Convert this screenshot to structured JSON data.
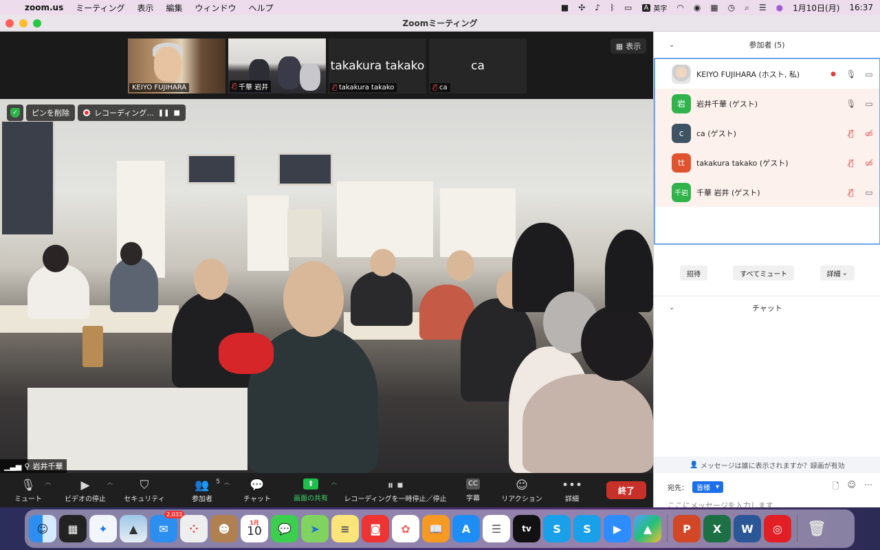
{
  "menubar": {
    "app": "zoom.us",
    "menus": [
      "ミーティング",
      "表示",
      "編集",
      "ウィンドウ",
      "ヘルプ"
    ],
    "ime": "A",
    "ime_label": "英字",
    "date": "1月10日(月)",
    "time": "16:37"
  },
  "window": {
    "title": "Zoomミーティング"
  },
  "thumbnails": [
    {
      "name": "KEIYO FUJIHARA"
    },
    {
      "name": "千華 岩井"
    },
    {
      "name": "takakura takako",
      "big": "takakura takako"
    },
    {
      "name": "ca",
      "big": "ca"
    }
  ],
  "view_button": "表示",
  "overlay": {
    "unpin": "ピンを削除",
    "recording": "レコーディング..."
  },
  "speaker_name": "岩井千華",
  "toolbar": {
    "mute": "ミュート",
    "video": "ビデオの停止",
    "security": "セキュリティ",
    "participants": "参加者",
    "participants_count": "5",
    "chat": "チャット",
    "share": "画面の共有",
    "recording": "レコーディングを一時停止／停止",
    "captions": "字幕",
    "captions_icon": "CC",
    "reactions": "リアクション",
    "more": "詳細",
    "end": "終了"
  },
  "participants_panel": {
    "title": "参加者 (5)",
    "rows": [
      {
        "avatar": "",
        "name": "KEIYO FUJIHARA (ホスト, 私)",
        "color": "#cfcfcf"
      },
      {
        "avatar": "岩",
        "name": "岩井千華 (ゲスト)",
        "color": "#2fb34a"
      },
      {
        "avatar": "c",
        "name": "ca (ゲスト)",
        "color": "#3e5363"
      },
      {
        "avatar": "tt",
        "name": "takakura takako (ゲスト)",
        "color": "#e0532f"
      },
      {
        "avatar": "千岩",
        "name": "千華 岩井 (ゲスト)",
        "color": "#2fb34a"
      }
    ],
    "invite": "招待",
    "mute_all": "すべてミュート",
    "more": "詳細"
  },
  "chat_panel": {
    "title": "チャット",
    "notice": "メッセージは誰に表示されますか？録画が有効",
    "to_label": "宛先：",
    "to_value": "皆様",
    "placeholder": "ここにメッセージを入力します..."
  },
  "dock": {
    "mail_badge": "2,033",
    "calendar_month": "1月",
    "calendar_day": "10",
    "appletv": "tv"
  }
}
